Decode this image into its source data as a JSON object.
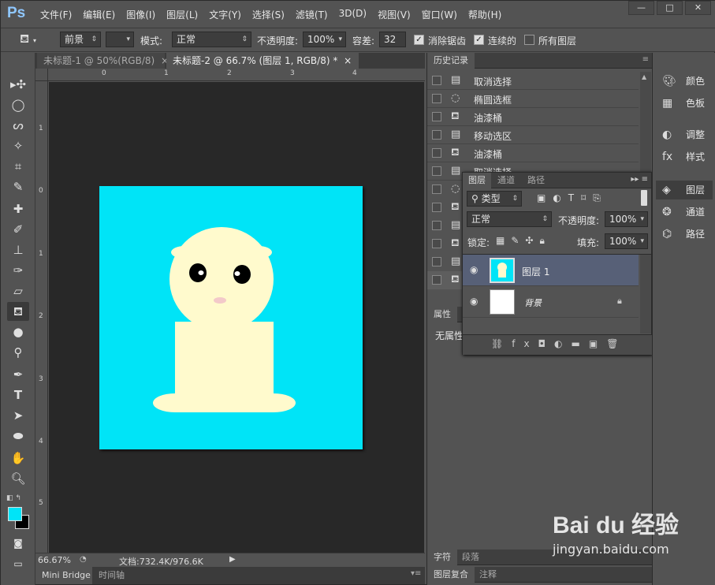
{
  "app": {
    "logo": "Ps"
  },
  "menu": [
    "文件(F)",
    "编辑(E)",
    "图像(I)",
    "图层(L)",
    "文字(Y)",
    "选择(S)",
    "滤镜(T)",
    "3D(D)",
    "视图(V)",
    "窗口(W)",
    "帮助(H)"
  ],
  "window_buttons": {
    "minimize": "—",
    "restore": "□",
    "close": "✕"
  },
  "options": {
    "fill_source": "前景",
    "mode_label": "模式:",
    "mode_value": "正常",
    "opacity_label": "不透明度:",
    "opacity_value": "100%",
    "tolerance_label": "容差:",
    "tolerance_value": "32",
    "antialias_label": "消除锯齿",
    "contiguous_label": "连续的",
    "all_layers_label": "所有图层"
  },
  "tabs": [
    {
      "label": "未标题-1 @ 50%(RGB/8)",
      "close": "×"
    },
    {
      "label": "未标题-2 @ 66.7% (图层 1, RGB/8) *",
      "close": "×"
    }
  ],
  "ruler_h_ticks": [
    "0",
    "1",
    "2",
    "3",
    "4"
  ],
  "ruler_v_ticks": [
    "1",
    "0",
    "1",
    "2",
    "3",
    "4",
    "5"
  ],
  "status": {
    "zoom": "66.67%",
    "doc_info": "文档:732.4K/976.6K"
  },
  "bottom_tabs": [
    "Mini Bridge",
    "时间轴"
  ],
  "history": {
    "title": "历史记录",
    "items": [
      {
        "icon": "doc-icon",
        "label": "取消选择"
      },
      {
        "icon": "ellipse-marquee-icon",
        "label": "椭圆选框"
      },
      {
        "icon": "bucket-icon",
        "label": "油漆桶"
      },
      {
        "icon": "doc-icon",
        "label": "移动选区"
      },
      {
        "icon": "bucket-icon",
        "label": "油漆桶"
      },
      {
        "icon": "doc-icon",
        "label": "取消选择"
      }
    ]
  },
  "layers": {
    "tabs": [
      "图层",
      "通道",
      "路径"
    ],
    "filter_label": "类型",
    "blend_mode": "正常",
    "opacity_label": "不透明度:",
    "opacity_value": "100%",
    "lock_label": "锁定:",
    "fill_label": "填充:",
    "fill_value": "100%",
    "items": [
      {
        "name": "图层 1",
        "visible": true,
        "selected": true
      },
      {
        "name": "背景",
        "visible": true,
        "locked": true
      }
    ]
  },
  "properties": {
    "title": "属性",
    "content": "无属性"
  },
  "lower_tabs": [
    "字符",
    "段落"
  ],
  "lower_tabs2": [
    "图层复合",
    "注释"
  ],
  "right_panels": [
    {
      "icon": "palette-icon",
      "label": "颜色"
    },
    {
      "icon": "swatches-icon",
      "label": "色板"
    },
    {
      "icon": "adjust-icon",
      "label": "调整"
    },
    {
      "icon": "fx-icon",
      "label": "样式"
    },
    {
      "icon": "layers-icon",
      "label": "图层"
    },
    {
      "icon": "channels-icon",
      "label": "通道"
    },
    {
      "icon": "paths-icon",
      "label": "路径"
    }
  ],
  "colors": {
    "foreground": "#00e4f7",
    "background": "#000000",
    "canvas_fill": "#00e4f7",
    "figure": "#fffacd"
  },
  "watermark": {
    "brand": "Bai du 经验",
    "url": "jingyan.baidu.com"
  }
}
